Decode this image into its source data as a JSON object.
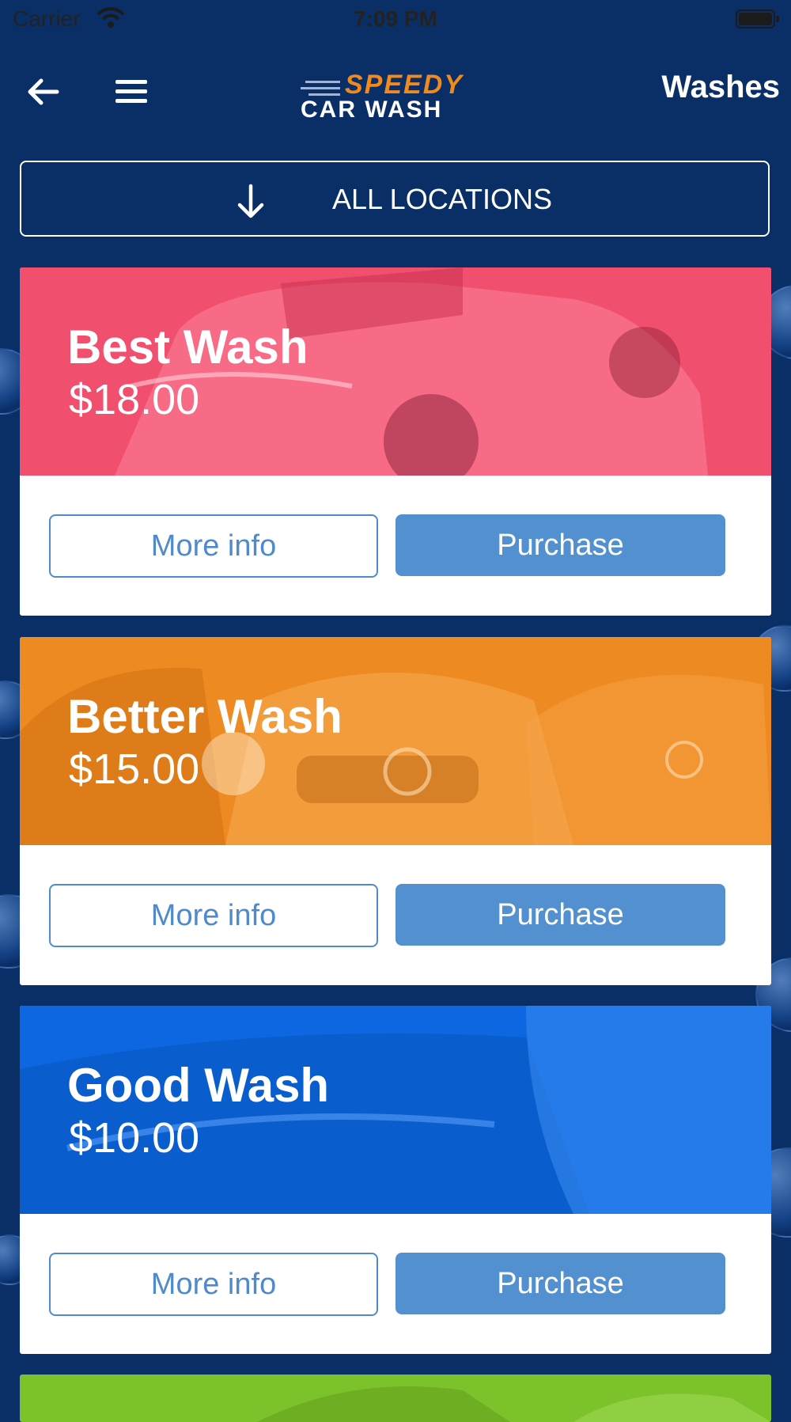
{
  "status_bar": {
    "carrier": "Carrier",
    "time": "7:09 PM"
  },
  "nav": {
    "title": "Washes",
    "logo": {
      "line1": "SPEEDY",
      "line2": "CAR WASH"
    },
    "icons": {
      "back": "arrow-left-icon",
      "menu": "hamburger-menu-icon"
    }
  },
  "location_filter": {
    "label": "ALL LOCATIONS",
    "icon": "arrow-down-icon"
  },
  "washes": [
    {
      "name": "Best Wash",
      "price": "$18.00",
      "more_info": "More info",
      "purchase": "Purchase",
      "color": "#f04f6d"
    },
    {
      "name": "Better Wash",
      "price": "$15.00",
      "more_info": "More info",
      "purchase": "Purchase",
      "color": "#ee8a22"
    },
    {
      "name": "Good Wash",
      "price": "$10.00",
      "more_info": "More info",
      "purchase": "Purchase",
      "color": "#0d67e0"
    }
  ],
  "next_card_color": "#7cc22a",
  "colors": {
    "background": "#0a2f66",
    "button_blue": "#5390d0",
    "logo_orange": "#f08a1c"
  }
}
